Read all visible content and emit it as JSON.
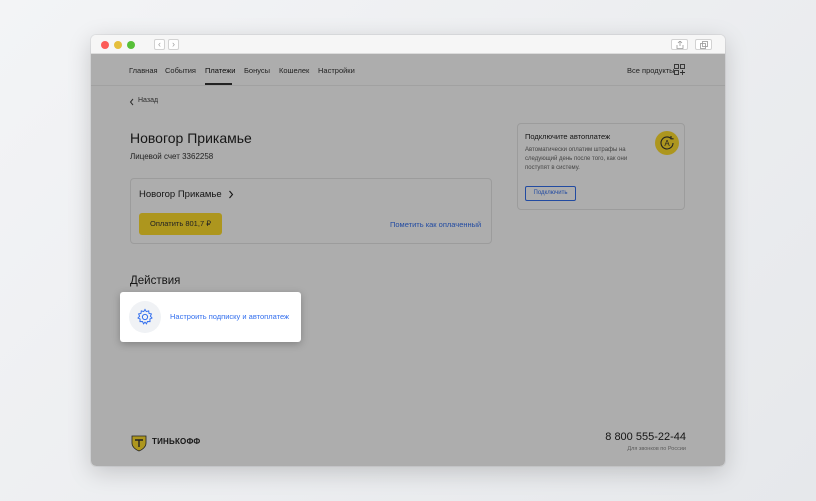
{
  "nav": {
    "items": [
      "Главная",
      "События",
      "Платежи",
      "Бонусы",
      "Кошелек",
      "Настройки"
    ],
    "active": "Платежи",
    "all_products": "Все продукты"
  },
  "back_label": "Назад",
  "payment": {
    "title": "Новогор Прикамье",
    "account": "Лицевой счет 3362258",
    "card_name": "Новогор Прикамье",
    "pay_button": "Оплатить 801,7 ₽",
    "mark_paid": "Пометить как оплаченный"
  },
  "autopay": {
    "title": "Подключите автоплатеж",
    "description": "Автоматически оплатим штрафы на следующий день после того, как они поступят в систему.",
    "button": "Подключить",
    "badge_letter": "A"
  },
  "actions": {
    "title": "Действия",
    "item": "Настроить подписку и автоплатеж"
  },
  "footer": {
    "brand": "ТИНЬКОФФ",
    "phone": "8 800 555-22-44",
    "note": "Для звонков по России"
  },
  "colors": {
    "accent_yellow": "#ffdd2d",
    "link_blue": "#336fee",
    "overlay": "rgba(0,0,0,0.32)"
  }
}
